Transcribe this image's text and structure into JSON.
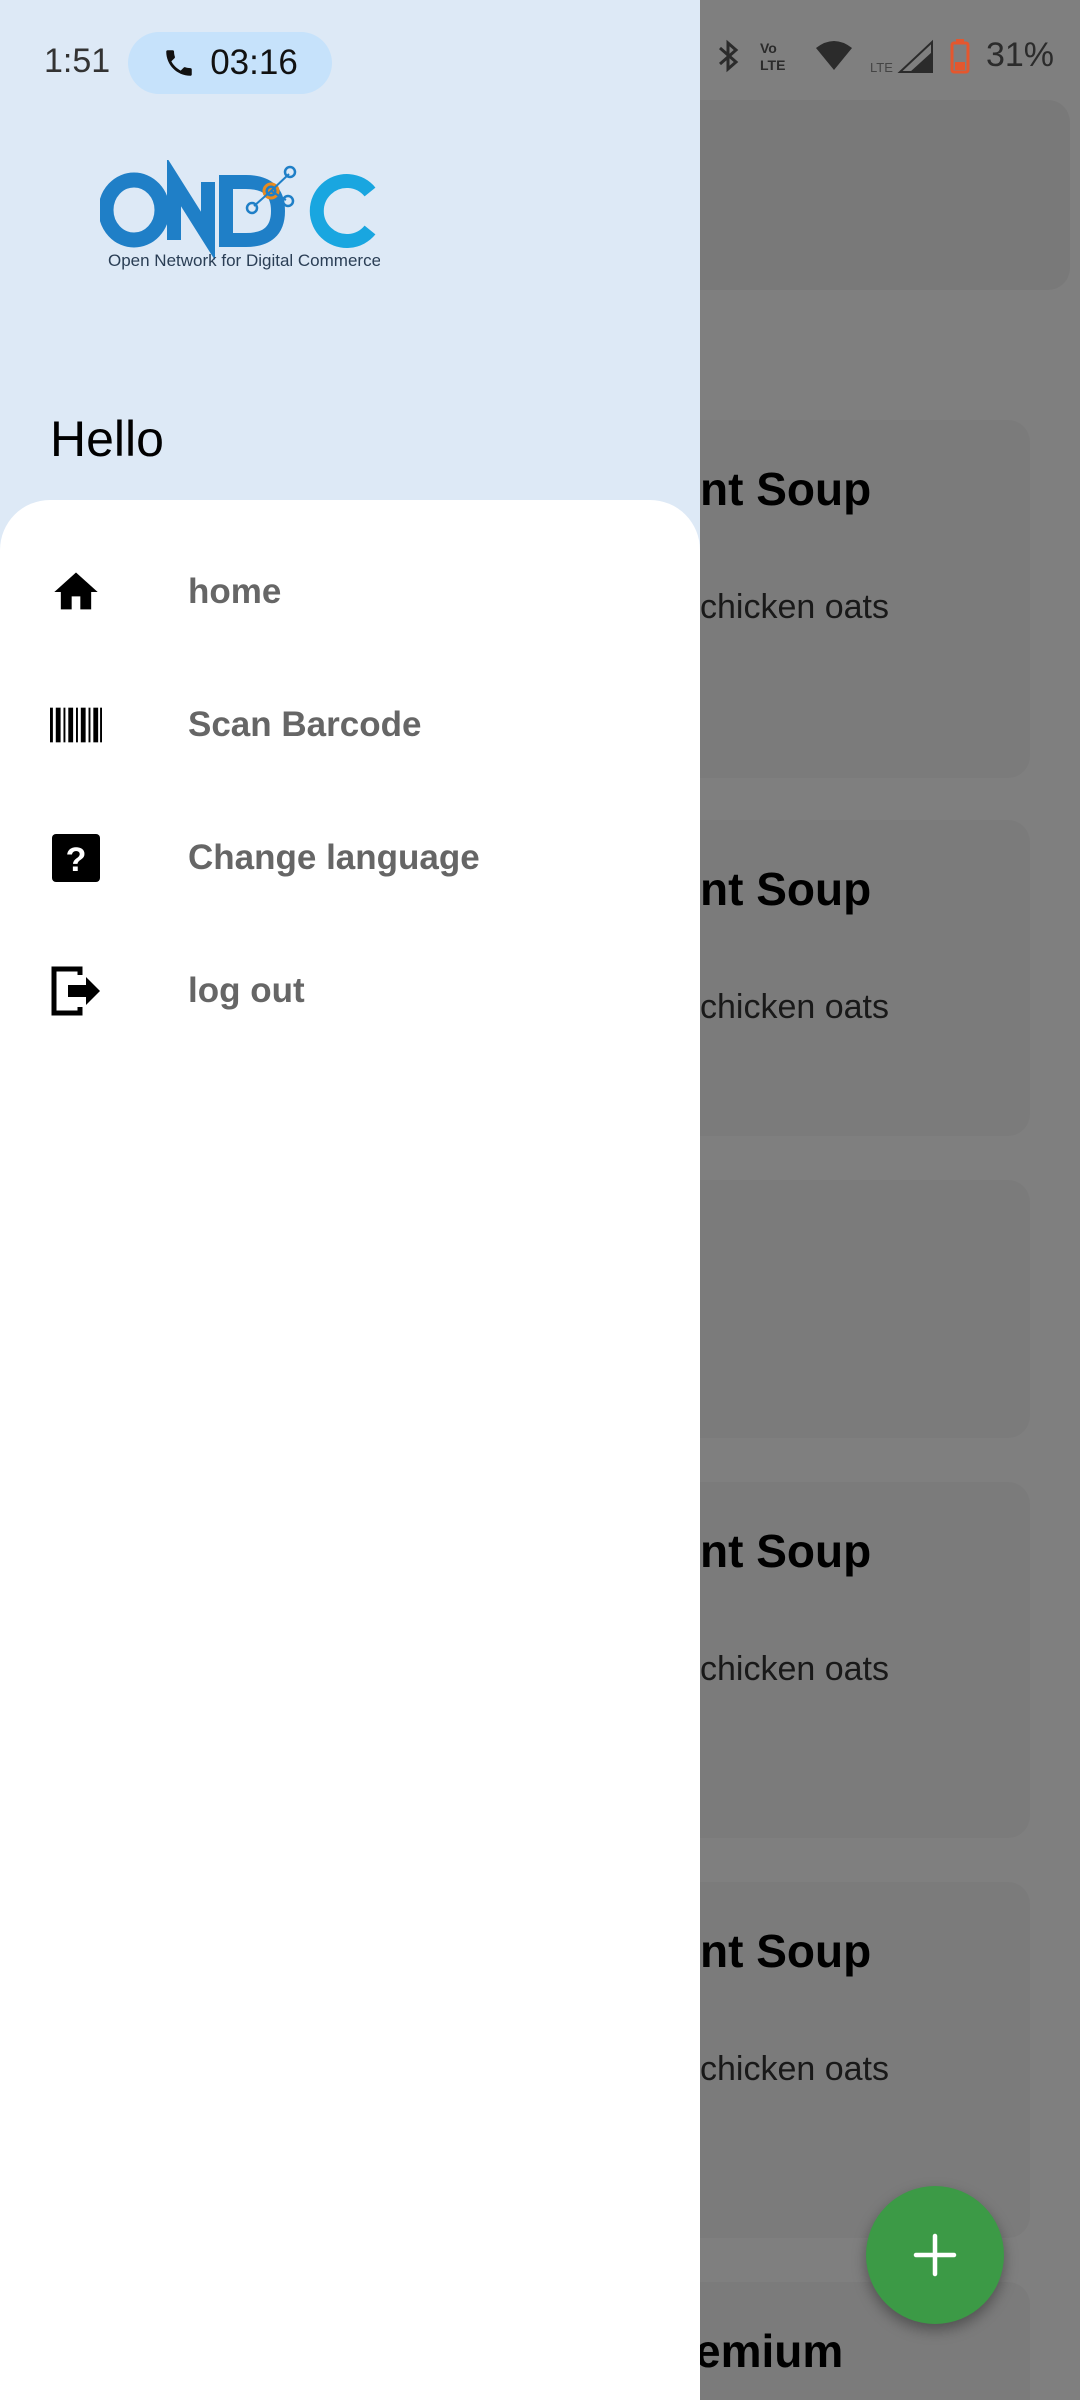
{
  "status_bar": {
    "time": "1:51",
    "call_timer": "03:16",
    "battery": "31%"
  },
  "drawer": {
    "logo_text": "ONDC",
    "logo_tagline": "Open Network for Digital Commerce",
    "greeting": "Hello",
    "menu": [
      {
        "label": "home",
        "icon": "home-icon"
      },
      {
        "label": "Scan Barcode",
        "icon": "barcode-icon"
      },
      {
        "label": "Change language",
        "icon": "help-icon"
      },
      {
        "label": "log out",
        "icon": "logout-icon"
      }
    ]
  },
  "background": {
    "cards": [
      {
        "title": "nt Soup",
        "subtitle": "chicken oats"
      },
      {
        "title": "nt Soup",
        "subtitle": "chicken oats"
      },
      {
        "title": "",
        "subtitle": ""
      },
      {
        "title": "nt Soup",
        "subtitle": "chicken oats"
      },
      {
        "title": "nt Soup",
        "subtitle": "chicken oats"
      },
      {
        "title": "emium",
        "subtitle": ""
      }
    ],
    "fab_icon": "plus-icon"
  },
  "colors": {
    "drawer_header": "#dde9f6",
    "call_chip": "#c6e2fb",
    "fab": "#3c9a46",
    "logo_blue": "#1f7fc7",
    "logo_cyan": "#19a6e0"
  }
}
